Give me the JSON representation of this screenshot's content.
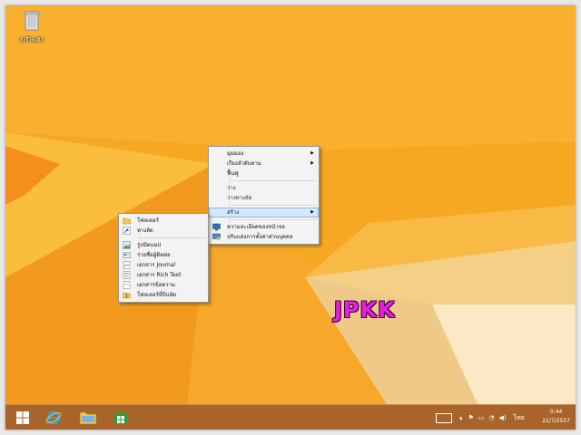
{
  "desktop": {
    "recycle_bin_label": "ถังรีไซเคิล",
    "recycle_bin_icon": "recycle-bin-icon",
    "watermark": "JPKK",
    "wallpaper_colors": {
      "base": "#f5a623",
      "light": "#fbc04a",
      "dark": "#e8850f"
    }
  },
  "context_menu": {
    "items": [
      {
        "label": "มุมมอง",
        "has_submenu": true
      },
      {
        "label": "เรียงลำดับตาม",
        "has_submenu": true
      },
      {
        "label": "ฟื้นฟู",
        "has_submenu": false
      },
      {
        "label": "วาง",
        "has_submenu": false
      },
      {
        "label": "วางทางลัด",
        "has_submenu": false
      },
      {
        "label": "สร้าง",
        "has_submenu": true,
        "highlighted": true
      },
      {
        "label": "ความละเอียดของหน้าจอ",
        "icon": "display-icon"
      },
      {
        "label": "ปรับแต่งการตั้งค่าส่วนบุคคล",
        "icon": "personalize-icon"
      }
    ]
  },
  "new_submenu": {
    "items": [
      {
        "label": "โฟลเดอร์",
        "icon": "folder-icon"
      },
      {
        "label": "ทางลัด",
        "icon": "shortcut-icon"
      },
      {
        "label": "รูปบิตแมป",
        "icon": "bitmap-icon"
      },
      {
        "label": "รายชื่อผู้ติดต่อ",
        "icon": "contact-icon"
      },
      {
        "label": "เอกสาร Journal",
        "icon": "journal-icon"
      },
      {
        "label": "เอกสาร Rich Text",
        "icon": "rich-text-icon"
      },
      {
        "label": "เอกสารข้อความ",
        "icon": "text-document-icon"
      },
      {
        "label": "โฟลเดอร์ที่บีบอัด",
        "icon": "zip-folder-icon"
      }
    ]
  },
  "taskbar": {
    "apps": [
      "start-icon",
      "internet-explorer-icon",
      "file-explorer-icon",
      "store-icon"
    ],
    "tray": {
      "language": "ไทย",
      "time": "0:44",
      "date": "22/7/2557"
    }
  }
}
